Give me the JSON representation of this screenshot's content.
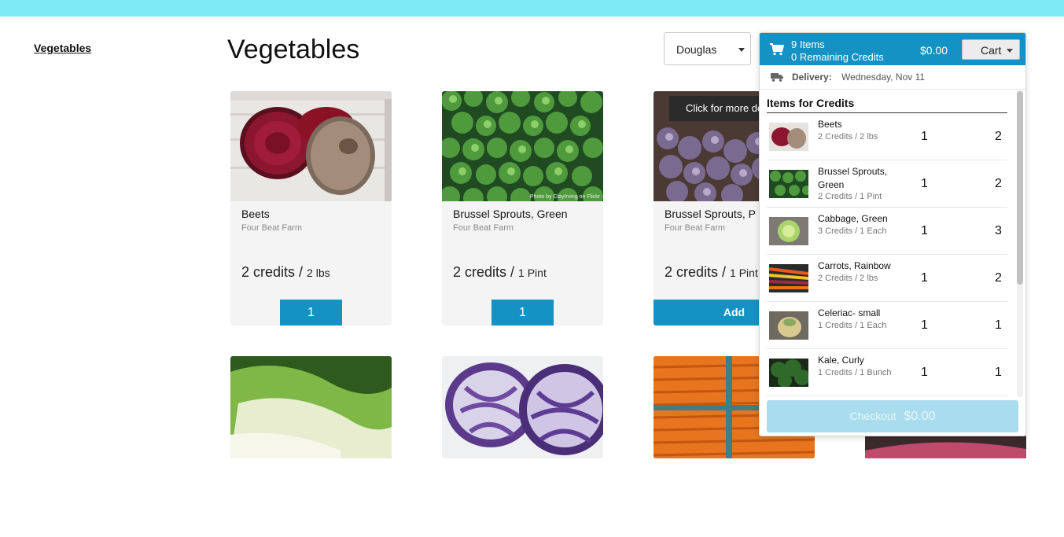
{
  "nav": {
    "category_link": "Vegetables"
  },
  "page": {
    "title": "Vegetables"
  },
  "user_select": {
    "value": "Douglas"
  },
  "products": [
    {
      "name": "Beets",
      "farm": "Four Beat Farm",
      "credits": "2 credits /",
      "unit": "2 lbs",
      "button": "1"
    },
    {
      "name": "Brussel Sprouts, Green",
      "farm": "Four Beat Farm",
      "credits": "2 credits /",
      "unit": "1 Pint",
      "button": "1",
      "photo_credit": "Photo by ClayIrving on Flickr"
    },
    {
      "name": "Brussel Sprouts, P",
      "farm": "Four Beat Farm",
      "credits": "2 credits /",
      "unit": "1 Pint",
      "button": "Add",
      "tooltip": "Click for more de"
    }
  ],
  "cart": {
    "item_count": "9 Items",
    "remaining_credits": "0 Remaining Credits",
    "total": "$0.00",
    "button_label": "Cart",
    "delivery_label": "Delivery:",
    "delivery_date": "Wednesday, Nov 11",
    "section_title": "Items for Credits",
    "items": [
      {
        "name": "Beets",
        "desc": "2 Credits / 2 lbs",
        "qty": "1",
        "credits": "2"
      },
      {
        "name": "Brussel Sprouts, Green",
        "desc": "2 Credits / 1 Pint",
        "qty": "1",
        "credits": "2"
      },
      {
        "name": "Cabbage, Green",
        "desc": "3 Credits / 1 Each",
        "qty": "1",
        "credits": "3"
      },
      {
        "name": "Carrots, Rainbow",
        "desc": "2 Credits / 2 lbs",
        "qty": "1",
        "credits": "2"
      },
      {
        "name": "Celeriac- small",
        "desc": "1 Credits / 1 Each",
        "qty": "1",
        "credits": "1"
      },
      {
        "name": "Kale, Curly",
        "desc": "1 Credits / 1 Bunch",
        "qty": "1",
        "credits": "1"
      }
    ],
    "checkout_label": "Checkout",
    "checkout_amount": "$0.00"
  },
  "colors": {
    "accent": "#1592c4",
    "topbar": "#7eeaf6",
    "checkout_disabled": "#a9dcec"
  }
}
